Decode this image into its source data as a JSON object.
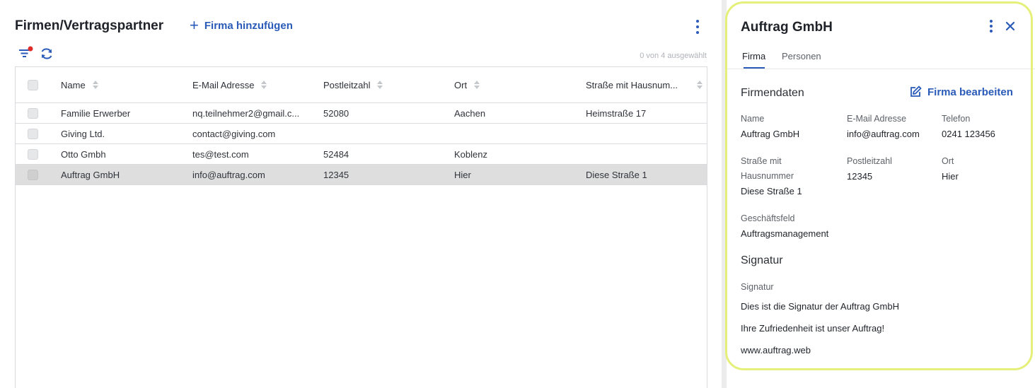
{
  "header": {
    "title": "Firmen/Vertragspartner",
    "add_label": "Firma hinzufügen",
    "selection_count": "0 von 4 ausgewählt"
  },
  "table": {
    "columns": [
      "Name",
      "E-Mail Adresse",
      "Postleitzahl",
      "Ort",
      "Straße mit Hausnum..."
    ],
    "rows": [
      {
        "name": "Familie Erwerber",
        "email": "nq.teilnehmer2@gmail.c...",
        "plz": "52080",
        "ort": "Aachen",
        "strasse": "Heimstraße 17"
      },
      {
        "name": "Giving Ltd.",
        "email": "contact@giving.com",
        "plz": "",
        "ort": "",
        "strasse": ""
      },
      {
        "name": "Otto Gmbh",
        "email": "tes@test.com",
        "plz": "52484",
        "ort": "Koblenz",
        "strasse": ""
      },
      {
        "name": "Auftrag GmbH",
        "email": "info@auftrag.com",
        "plz": "12345",
        "ort": "Hier",
        "strasse": "Diese Straße 1"
      }
    ]
  },
  "panel": {
    "title": "Auftrag GmbH",
    "tabs": [
      "Firma",
      "Personen"
    ],
    "section_firmendaten": "Firmendaten",
    "edit_label": "Firma bearbeiten",
    "fields": {
      "name_label": "Name",
      "name_value": "Auftrag GmbH",
      "email_label": "E-Mail Adresse",
      "email_value": "info@auftrag.com",
      "telefon_label": "Telefon",
      "telefon_value": "0241 123456",
      "strasse_label_1": "Straße mit",
      "strasse_label_2": "Hausnummer",
      "strasse_value": "Diese Straße 1",
      "plz_label": "Postleitzahl",
      "plz_value": "12345",
      "ort_label": "Ort",
      "ort_value": "Hier",
      "geschaeftsfeld_label": "Geschäftsfeld",
      "geschaeftsfeld_value": "Auftragsmanagement"
    },
    "section_signatur": "Signatur",
    "signatur_label": "Signatur",
    "signatur_lines": [
      "Dies ist die Signatur der Auftrag GmbH",
      "Ihre Zufriedenheit ist unser Auftrag!",
      "www.auftrag.web"
    ]
  },
  "colors": {
    "accent": "#2a5bb8",
    "highlight_frame": "#e4f07a",
    "filter_badge": "#e02b2b",
    "selected_row": "#dedede"
  },
  "icons": [
    "plus-icon",
    "kebab-menu-icon",
    "filter-icon",
    "refresh-icon",
    "sort-icon",
    "close-icon",
    "edit-icon"
  ]
}
